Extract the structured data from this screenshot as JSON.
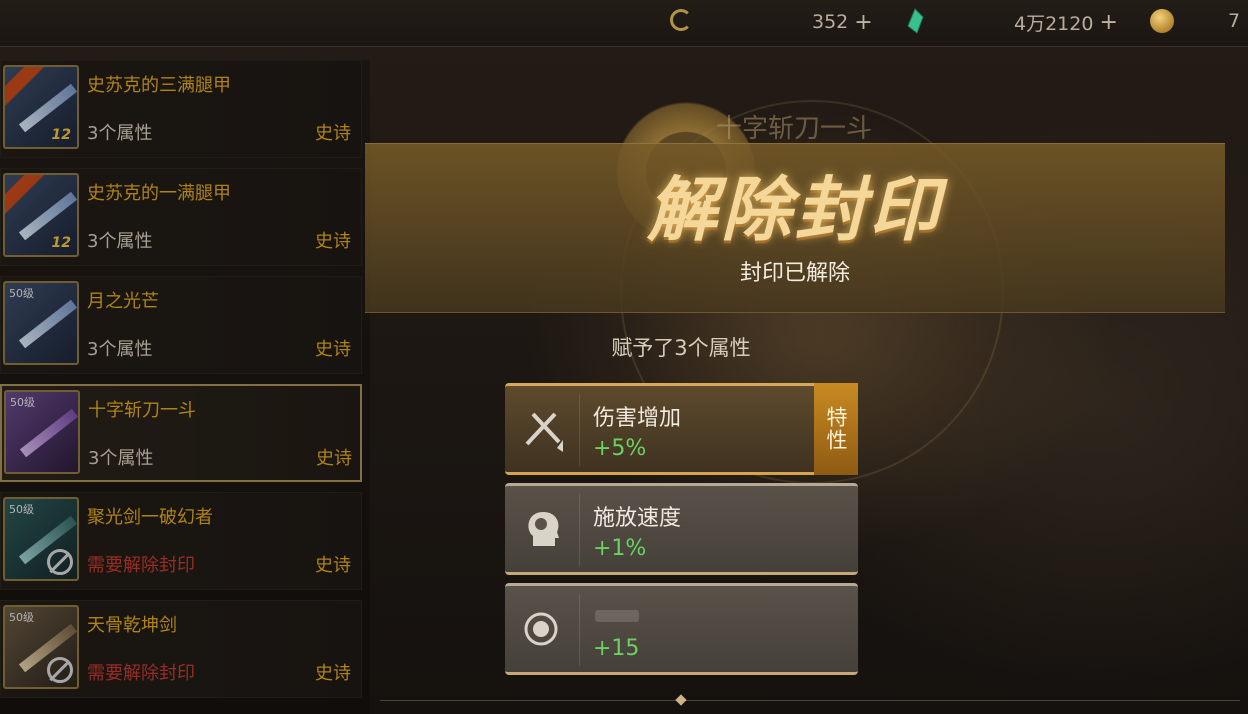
{
  "topbar": {
    "moon_currency": "352",
    "gem_currency": "4万2120",
    "coin_currency": "7",
    "plus": "+"
  },
  "items": [
    {
      "name": "史苏克的三满腿甲",
      "attr": "3个属性",
      "rarity": "史诗",
      "badge": "12"
    },
    {
      "name": "史苏克的一满腿甲",
      "attr": "3个属性",
      "rarity": "史诗",
      "badge": "12"
    },
    {
      "name": "月之光芒",
      "attr": "3个属性",
      "rarity": "史诗",
      "level": "50级"
    },
    {
      "name": "十字斩刀一斗",
      "attr": "3个属性",
      "rarity": "史诗",
      "level": "50级"
    },
    {
      "name": "聚光剑一破幻者",
      "attr": "需要解除封印",
      "rarity": "史诗",
      "level": "50级"
    },
    {
      "name": "天骨乾坤剑",
      "attr": "需要解除封印",
      "rarity": "史诗",
      "level": "50级"
    }
  ],
  "modal": {
    "bg_title": "十字斩刀一斗",
    "title": "解除封印",
    "subtitle": "封印已解除",
    "granted": "赋予了3个属性",
    "attributes": [
      {
        "name": "伤害增加",
        "value": "+5%",
        "tag": "特性",
        "icon": "swords-icon"
      },
      {
        "name": "施放速度",
        "value": "+1%",
        "icon": "head-icon"
      },
      {
        "name": "",
        "value": "+15",
        "icon": "target-icon"
      }
    ]
  },
  "colors": {
    "gold_text": "#e0a81e",
    "value_green": "#69d261",
    "warning_red": "#c23a2f"
  }
}
